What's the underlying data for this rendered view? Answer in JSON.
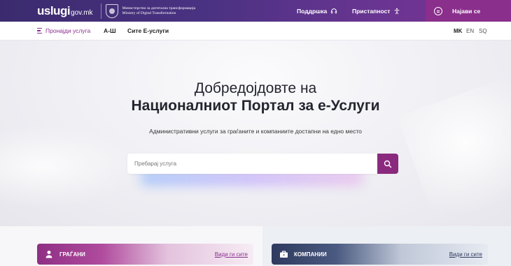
{
  "topbar": {
    "logo_main": "uslugi",
    "logo_sub": "gov.mk",
    "ministry_line1": "Министерство за дигитална трансформација",
    "ministry_line2": "Ministry of Digital Transformation",
    "support_label": "Поддршка",
    "support_icon": "headset-icon",
    "accessibility_label": "Пристапност",
    "accessibility_icon": "accessibility-icon",
    "login_label": "Најави се",
    "login_icon": "id-card-icon"
  },
  "nav": {
    "find_service": "Пронајди услуга",
    "az": "А-Ш",
    "all_services": "Сите Е-услуги",
    "languages": [
      "MK",
      "EN",
      "SQ"
    ],
    "active_language": "MK"
  },
  "hero": {
    "title_line1": "Добредојдовте на",
    "title_bold": "Националниот Портал",
    "title_rest": " за е-Услуги",
    "subtitle": "Административни услуги за граѓаните и компаниите достапни на едно место",
    "search_placeholder": "Пребарај услуга",
    "search_icon": "search-icon"
  },
  "cards": {
    "citizens": {
      "label": "ГРАЃАНИ",
      "link": "Види ги сите",
      "icon": "person-icon"
    },
    "companies": {
      "label": "КОМПАНИИ",
      "link": "Види ги сите",
      "icon": "briefcase-icon"
    }
  },
  "colors": {
    "brand_purple": "#8a2f8c",
    "topbar_start": "#3b2b6e",
    "companies_navy": "#2e3a5e"
  }
}
